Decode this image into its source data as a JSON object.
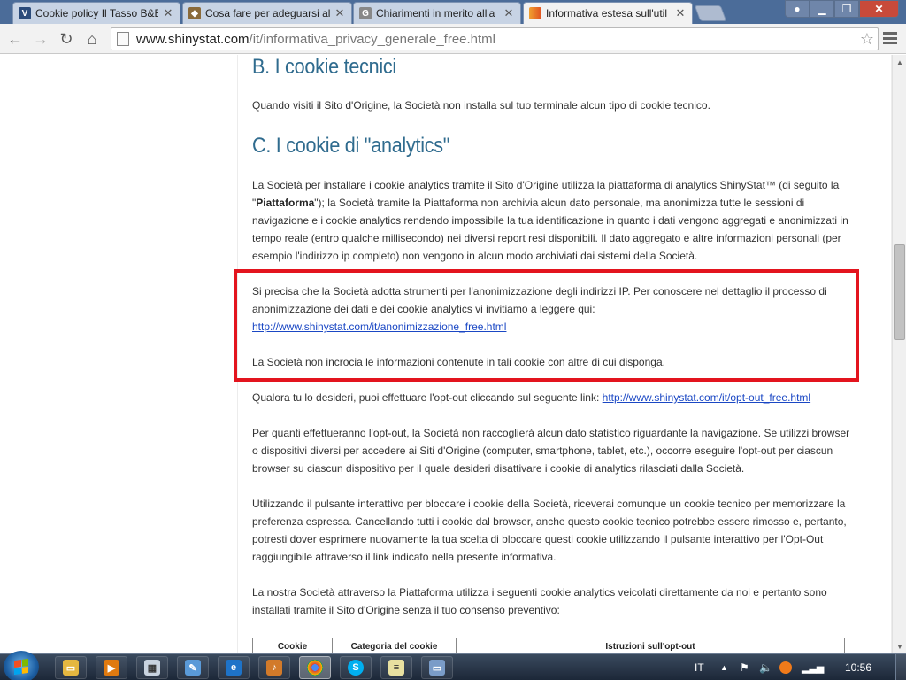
{
  "browser": {
    "tabs": [
      {
        "label": "Cookie policy Il Tasso B&B",
        "favicon": "tasso-favicon",
        "active": false
      },
      {
        "label": "Cosa fare per adeguarsi al",
        "favicon": "shield-favicon",
        "active": false
      },
      {
        "label": "Chiarimenti in merito all'a",
        "favicon": "google-favicon",
        "active": false
      },
      {
        "label": "Informativa estesa sull'util",
        "favicon": "shinystat-favicon",
        "active": true
      }
    ],
    "address": {
      "host": "www.shinystat.com",
      "path": "/it/informativa_privacy_generale_free.html"
    }
  },
  "page": {
    "heading_b": "B. I cookie tecnici",
    "para_b": "Quando visiti il Sito d'Origine, la Società non installa sul tuo terminale alcun tipo di cookie tecnico.",
    "heading_c": "C. I cookie di \"analytics\"",
    "para_c1_pre": "La Società per installare i cookie analytics tramite il Sito d'Origine utilizza la piattaforma di analytics ShinyStat™ (di seguito la \"",
    "para_c1_bold": "Piattaforma",
    "para_c1_post": "\"); la Società tramite la Piattaforma non archivia alcun dato personale, ma anonimizza tutte le sessioni di navigazione e i cookie analytics rendendo impossibile la tua identificazione in quanto i dati vengono aggregati e anonimizzati in tempo reale (entro qualche millisecondo) nei diversi report resi disponibili. Il dato aggregato e altre informazioni personali (per esempio l'indirizzo ip completo) non vengono in alcun modo archiviati dai sistemi della Società.",
    "para_anon": "Si precisa che la Società adotta strumenti per l'anonimizzazione degli indirizzi IP. Per conoscere nel dettaglio il processo di anonimizzazione dei dati e dei cookie analytics vi invitiamo a leggere qui:",
    "link_anon": "http://www.shinystat.com/it/anonimizzazione_free.html",
    "para_cross": "La Società non incrocia le informazioni contenute in tali cookie con altre di cui disponga.",
    "para_optout_pre": "Qualora tu lo desideri, puoi effettuare l'opt-out cliccando sul seguente link: ",
    "link_optout": "http://www.shinystat.com/it/opt-out_free.html",
    "para_optout_effect": "Per quanti effettueranno l'opt-out, la Società non raccoglierà alcun dato statistico riguardante la navigazione. Se utilizzi browser o dispositivi diversi per accedere ai Siti d'Origine (computer, smartphone, tablet, etc.), occorre eseguire l'opt-out per ciascun browser su ciascun dispositivo per il quale desideri disattivare i cookie di analytics rilasciati dalla Società.",
    "para_button": "Utilizzando il pulsante interattivo per bloccare i cookie della Società, riceverai comunque un cookie tecnico per memorizzare la preferenza espressa. Cancellando tutti i cookie dal browser, anche questo cookie tecnico potrebbe essere rimosso e, pertanto, potresti dover esprimere nuovamente la tua scelta di bloccare questi cookie utilizzando il pulsante interattivo per l'Opt-Out raggiungibile attraverso il link indicato nella presente informativa.",
    "para_platform": "La nostra Società attraverso la Piattaforma utilizza i seguenti cookie analytics veicolati direttamente da noi e pertanto sono installati tramite il Sito d'Origine senza il tuo consenso preventivo:",
    "table_headers": [
      "Cookie",
      "Categoria del cookie",
      "Istruzioni sull'opt-out"
    ]
  },
  "taskbar": {
    "apps": [
      "explorer-icon",
      "media-player-icon",
      "calculator-icon",
      "paint-icon",
      "internet-explorer-icon",
      "winamp-icon",
      "chrome-icon",
      "skype-icon",
      "notepad-icon",
      "window-icon"
    ],
    "active_app": "chrome-icon",
    "language": "IT",
    "clock": "10:56"
  },
  "colors": {
    "heading": "#2f6b8e",
    "link": "#1a47c4",
    "highlight_box": "#e3141e",
    "tabstrip": "#4b6c99"
  }
}
